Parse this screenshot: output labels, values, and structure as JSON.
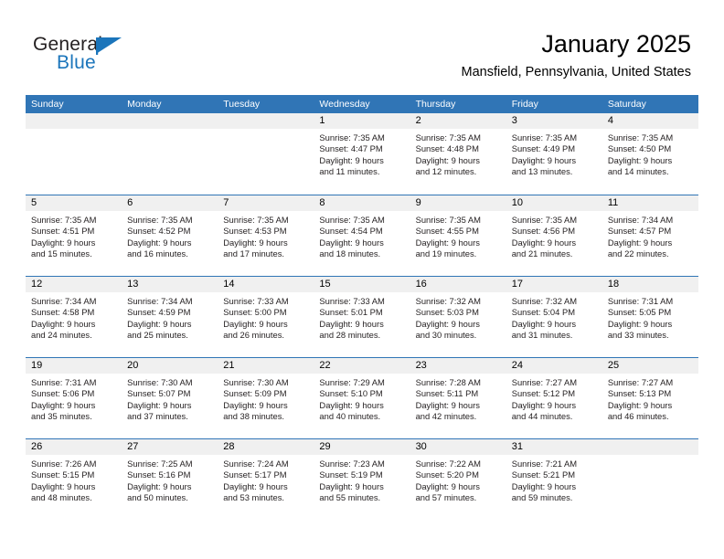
{
  "brand": {
    "name_part1": "General",
    "name_part2": "Blue",
    "flag_icon": "blue-triangle-flag",
    "accent_color": "#1b75bb"
  },
  "header": {
    "title": "January 2025",
    "subtitle": "Mansfield, Pennsylvania, United States"
  },
  "theme": {
    "header_blue": "#3075b6",
    "day_band_gray": "#f0f0f0",
    "text_color": "#231f20"
  },
  "calendar": {
    "day_headers": [
      "Sunday",
      "Monday",
      "Tuesday",
      "Wednesday",
      "Thursday",
      "Friday",
      "Saturday"
    ],
    "weeks": [
      [
        {
          "day": "",
          "lines": []
        },
        {
          "day": "",
          "lines": []
        },
        {
          "day": "",
          "lines": []
        },
        {
          "day": "1",
          "lines": [
            "Sunrise: 7:35 AM",
            "Sunset: 4:47 PM",
            "Daylight: 9 hours",
            "and 11 minutes."
          ]
        },
        {
          "day": "2",
          "lines": [
            "Sunrise: 7:35 AM",
            "Sunset: 4:48 PM",
            "Daylight: 9 hours",
            "and 12 minutes."
          ]
        },
        {
          "day": "3",
          "lines": [
            "Sunrise: 7:35 AM",
            "Sunset: 4:49 PM",
            "Daylight: 9 hours",
            "and 13 minutes."
          ]
        },
        {
          "day": "4",
          "lines": [
            "Sunrise: 7:35 AM",
            "Sunset: 4:50 PM",
            "Daylight: 9 hours",
            "and 14 minutes."
          ]
        }
      ],
      [
        {
          "day": "5",
          "lines": [
            "Sunrise: 7:35 AM",
            "Sunset: 4:51 PM",
            "Daylight: 9 hours",
            "and 15 minutes."
          ]
        },
        {
          "day": "6",
          "lines": [
            "Sunrise: 7:35 AM",
            "Sunset: 4:52 PM",
            "Daylight: 9 hours",
            "and 16 minutes."
          ]
        },
        {
          "day": "7",
          "lines": [
            "Sunrise: 7:35 AM",
            "Sunset: 4:53 PM",
            "Daylight: 9 hours",
            "and 17 minutes."
          ]
        },
        {
          "day": "8",
          "lines": [
            "Sunrise: 7:35 AM",
            "Sunset: 4:54 PM",
            "Daylight: 9 hours",
            "and 18 minutes."
          ]
        },
        {
          "day": "9",
          "lines": [
            "Sunrise: 7:35 AM",
            "Sunset: 4:55 PM",
            "Daylight: 9 hours",
            "and 19 minutes."
          ]
        },
        {
          "day": "10",
          "lines": [
            "Sunrise: 7:35 AM",
            "Sunset: 4:56 PM",
            "Daylight: 9 hours",
            "and 21 minutes."
          ]
        },
        {
          "day": "11",
          "lines": [
            "Sunrise: 7:34 AM",
            "Sunset: 4:57 PM",
            "Daylight: 9 hours",
            "and 22 minutes."
          ]
        }
      ],
      [
        {
          "day": "12",
          "lines": [
            "Sunrise: 7:34 AM",
            "Sunset: 4:58 PM",
            "Daylight: 9 hours",
            "and 24 minutes."
          ]
        },
        {
          "day": "13",
          "lines": [
            "Sunrise: 7:34 AM",
            "Sunset: 4:59 PM",
            "Daylight: 9 hours",
            "and 25 minutes."
          ]
        },
        {
          "day": "14",
          "lines": [
            "Sunrise: 7:33 AM",
            "Sunset: 5:00 PM",
            "Daylight: 9 hours",
            "and 26 minutes."
          ]
        },
        {
          "day": "15",
          "lines": [
            "Sunrise: 7:33 AM",
            "Sunset: 5:01 PM",
            "Daylight: 9 hours",
            "and 28 minutes."
          ]
        },
        {
          "day": "16",
          "lines": [
            "Sunrise: 7:32 AM",
            "Sunset: 5:03 PM",
            "Daylight: 9 hours",
            "and 30 minutes."
          ]
        },
        {
          "day": "17",
          "lines": [
            "Sunrise: 7:32 AM",
            "Sunset: 5:04 PM",
            "Daylight: 9 hours",
            "and 31 minutes."
          ]
        },
        {
          "day": "18",
          "lines": [
            "Sunrise: 7:31 AM",
            "Sunset: 5:05 PM",
            "Daylight: 9 hours",
            "and 33 minutes."
          ]
        }
      ],
      [
        {
          "day": "19",
          "lines": [
            "Sunrise: 7:31 AM",
            "Sunset: 5:06 PM",
            "Daylight: 9 hours",
            "and 35 minutes."
          ]
        },
        {
          "day": "20",
          "lines": [
            "Sunrise: 7:30 AM",
            "Sunset: 5:07 PM",
            "Daylight: 9 hours",
            "and 37 minutes."
          ]
        },
        {
          "day": "21",
          "lines": [
            "Sunrise: 7:30 AM",
            "Sunset: 5:09 PM",
            "Daylight: 9 hours",
            "and 38 minutes."
          ]
        },
        {
          "day": "22",
          "lines": [
            "Sunrise: 7:29 AM",
            "Sunset: 5:10 PM",
            "Daylight: 9 hours",
            "and 40 minutes."
          ]
        },
        {
          "day": "23",
          "lines": [
            "Sunrise: 7:28 AM",
            "Sunset: 5:11 PM",
            "Daylight: 9 hours",
            "and 42 minutes."
          ]
        },
        {
          "day": "24",
          "lines": [
            "Sunrise: 7:27 AM",
            "Sunset: 5:12 PM",
            "Daylight: 9 hours",
            "and 44 minutes."
          ]
        },
        {
          "day": "25",
          "lines": [
            "Sunrise: 7:27 AM",
            "Sunset: 5:13 PM",
            "Daylight: 9 hours",
            "and 46 minutes."
          ]
        }
      ],
      [
        {
          "day": "26",
          "lines": [
            "Sunrise: 7:26 AM",
            "Sunset: 5:15 PM",
            "Daylight: 9 hours",
            "and 48 minutes."
          ]
        },
        {
          "day": "27",
          "lines": [
            "Sunrise: 7:25 AM",
            "Sunset: 5:16 PM",
            "Daylight: 9 hours",
            "and 50 minutes."
          ]
        },
        {
          "day": "28",
          "lines": [
            "Sunrise: 7:24 AM",
            "Sunset: 5:17 PM",
            "Daylight: 9 hours",
            "and 53 minutes."
          ]
        },
        {
          "day": "29",
          "lines": [
            "Sunrise: 7:23 AM",
            "Sunset: 5:19 PM",
            "Daylight: 9 hours",
            "and 55 minutes."
          ]
        },
        {
          "day": "30",
          "lines": [
            "Sunrise: 7:22 AM",
            "Sunset: 5:20 PM",
            "Daylight: 9 hours",
            "and 57 minutes."
          ]
        },
        {
          "day": "31",
          "lines": [
            "Sunrise: 7:21 AM",
            "Sunset: 5:21 PM",
            "Daylight: 9 hours",
            "and 59 minutes."
          ]
        },
        {
          "day": "",
          "lines": []
        }
      ]
    ]
  }
}
